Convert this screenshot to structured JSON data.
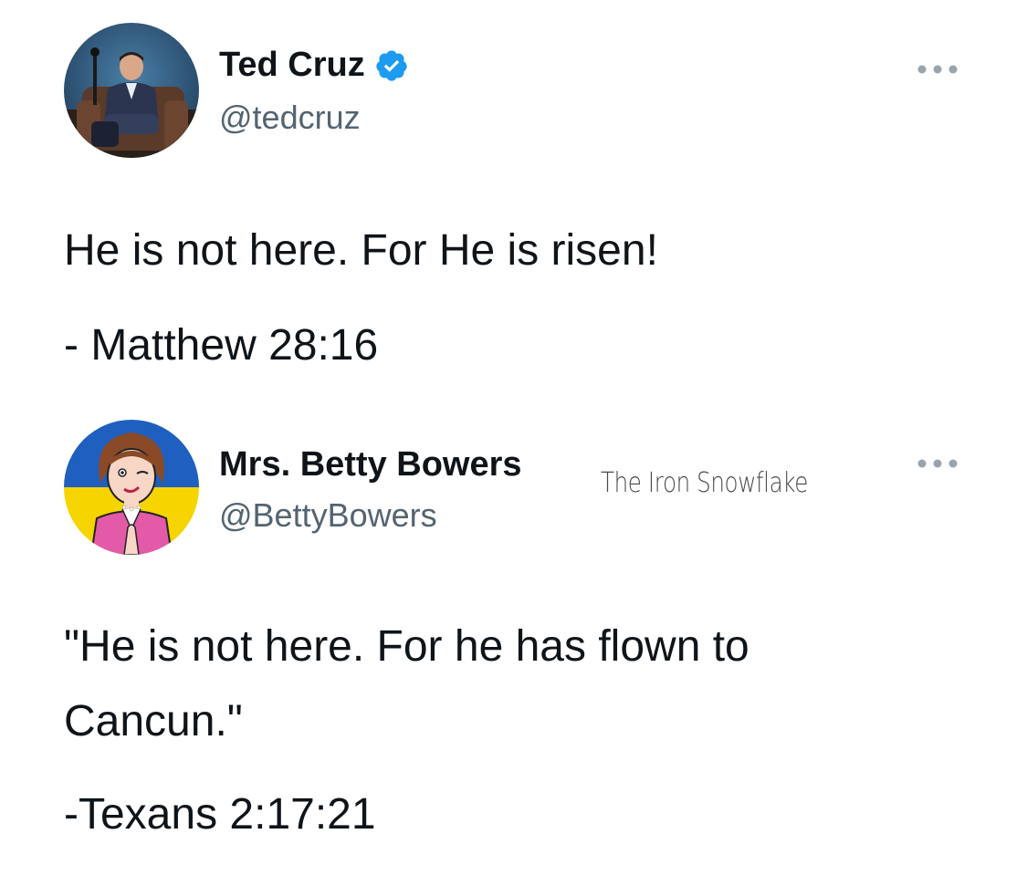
{
  "tweets": [
    {
      "author": {
        "display_name": "Ted Cruz",
        "handle": "@tedcruz",
        "verified": true,
        "avatar_icon": "man-in-armchair-photo"
      },
      "text_lines": [
        "He is not here. For He is risen!",
        "- Matthew 28:16"
      ]
    },
    {
      "author": {
        "display_name": "Mrs. Betty Bowers",
        "handle": "@BettyBowers",
        "verified": false,
        "avatar_icon": "cartoon-woman-ukraine-flag"
      },
      "text_lines": [
        "\"He is not here. For he has flown to",
        "Cancun.\"",
        "-Texans 2:17:21"
      ]
    }
  ],
  "watermark": "The Iron Snowflake",
  "colors": {
    "verified_blue": "#1d9bf0",
    "handle_gray": "#536471",
    "text": "#0f1419",
    "flag_blue": "#1f5fbf",
    "flag_yellow": "#f6d400"
  }
}
